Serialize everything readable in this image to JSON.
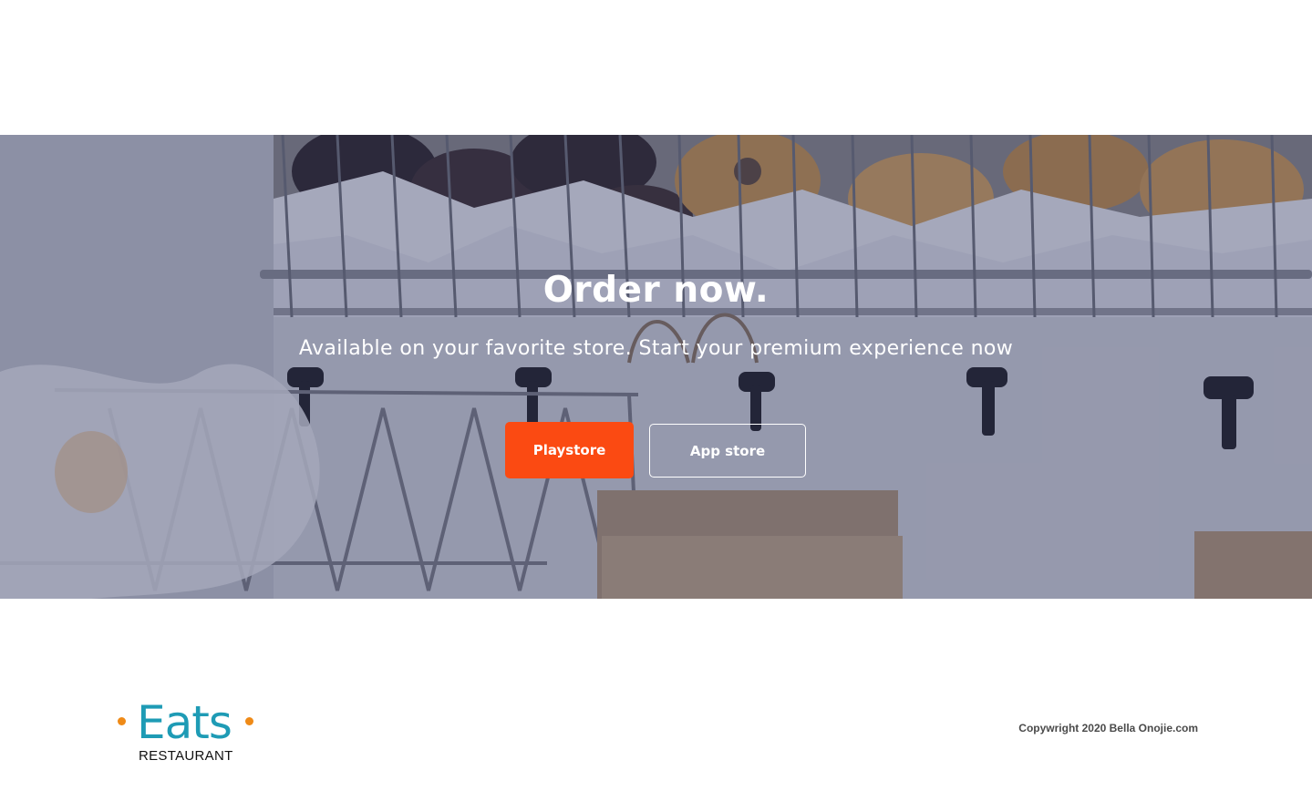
{
  "hero": {
    "title": "Order now.",
    "subtitle": "Available on your favorite store. Start your premium experience now",
    "playstore_label": "Playstore",
    "appstore_label": "App store"
  },
  "footer": {
    "logo_word": "Eats",
    "logo_sub": "RESTAURANT",
    "copyright": "Copywright 2020 Bella Onojie.com"
  },
  "colors": {
    "accent": "#fb4a12",
    "logo_text": "#1e9bb5",
    "logo_dots": "#ef8a17",
    "overlay": "#30345c"
  }
}
